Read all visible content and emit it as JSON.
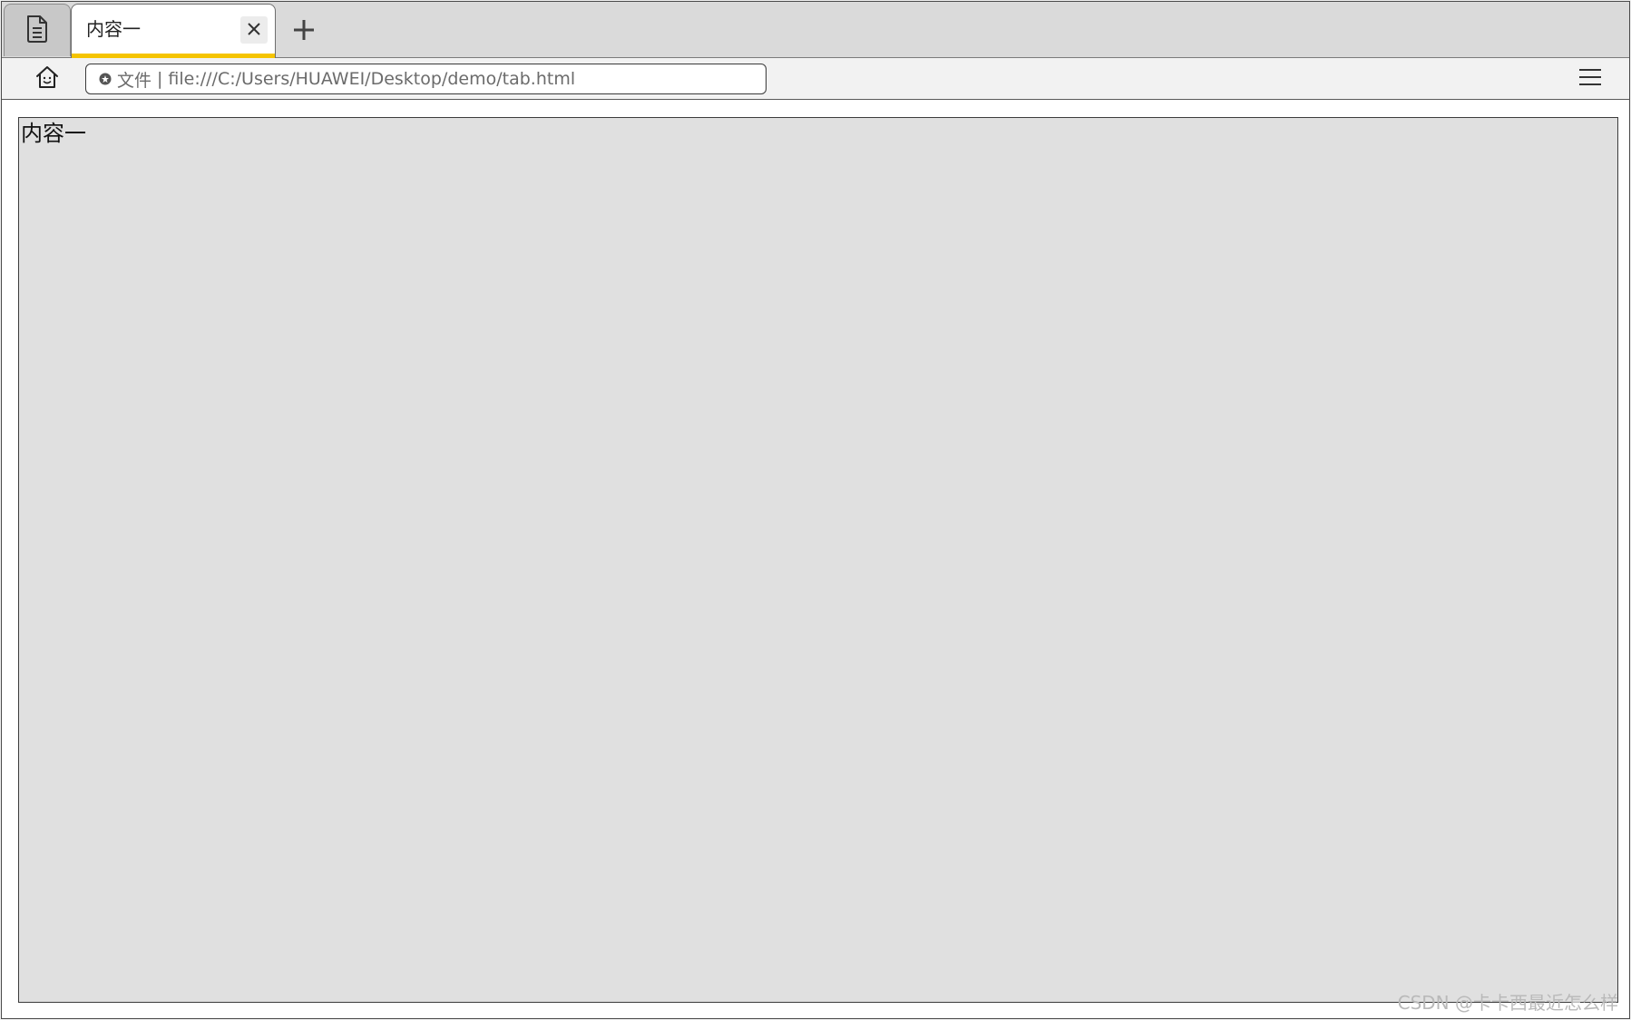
{
  "tabs": [
    {
      "title": "内容一",
      "active": true
    }
  ],
  "address_bar": {
    "scheme_label": "文件",
    "separator": "|",
    "url": "file:///C:/Users/HUAWEI/Desktop/demo/tab.html"
  },
  "content": {
    "text": "内容一"
  },
  "watermark": "CSDN @卡卡西最近怎么样",
  "icons": {
    "tab_menu": "document-icon",
    "tab_close": "close-icon",
    "new_tab": "plus-icon",
    "home": "home-icon",
    "site_info": "info-icon",
    "menu": "hamburger-menu-icon"
  },
  "colors": {
    "active_tab_accent": "#f5c400",
    "content_background": "#e0e0e0",
    "tabstrip_background": "#dadada"
  }
}
